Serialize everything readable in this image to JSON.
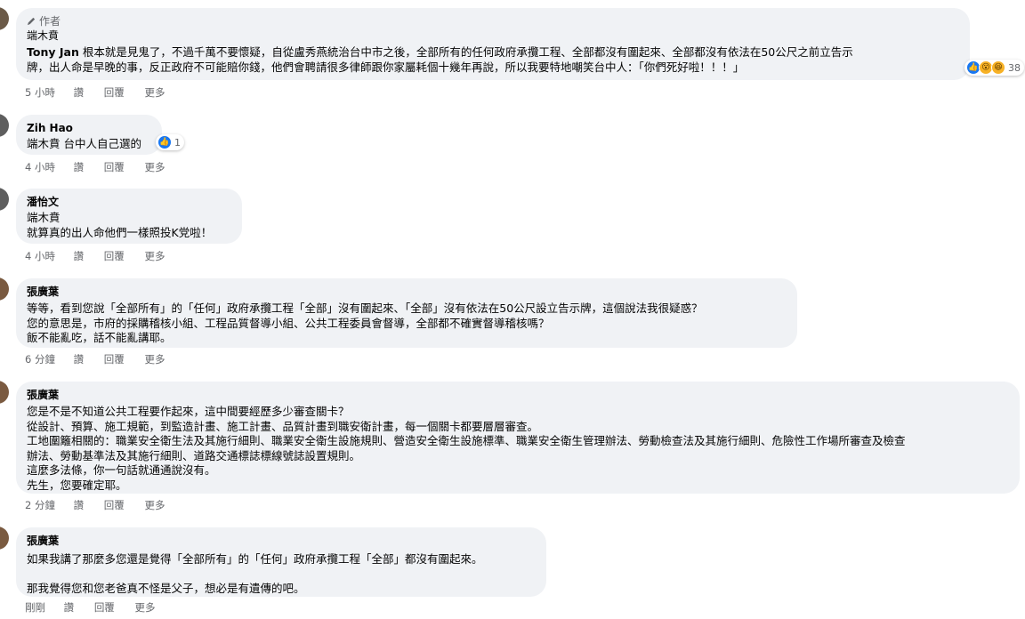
{
  "actions": {
    "like": "讚",
    "reply": "回覆",
    "more": "更多"
  },
  "comments": [
    {
      "badge": "作者",
      "author": "端木賁",
      "lines": [
        {
          "tag": "Tony Jan",
          "text": " 根本就是見鬼了，不過千萬不要懷疑，自從盧秀燕統治台中市之後，全部所有的任何政府承攬工程、全部都沒有圍起來、全部都沒有依法在50公尺之前立告示"
        },
        {
          "tag": "",
          "text": "牌，出人命是早晚的事，反正政府不可能賠你錢，他們會聘請很多律師跟你家屬耗個十幾年再說，所以我要特地嘲笑台中人：「你們死好啦！！！」"
        }
      ],
      "reactions": {
        "icons": [
          "like-icon",
          "wow-icon",
          "haha-icon"
        ],
        "count": "38"
      },
      "time": "5 小時"
    },
    {
      "author": "Zih Hao",
      "lines": [
        {
          "tag": "端木賁",
          "text": " 台中人自己選的"
        }
      ],
      "reactions": {
        "icons": [
          "like-icon"
        ],
        "count": "1"
      },
      "time": "4 小時"
    },
    {
      "author": "潘怡文",
      "lines": [
        {
          "tag": "端木賁",
          "text": ""
        },
        {
          "tag": "",
          "text": "就算真的出人命他們一樣照投K党啦！"
        }
      ],
      "time": "4 小時"
    },
    {
      "author": "張廣葉",
      "lines": [
        {
          "tag": "",
          "text": "等等，看到您說「全部所有」的「任何」政府承攬工程「全部」沒有圍起來、「全部」沒有依法在50公尺設立告示牌，這個說法我很疑惑？"
        },
        {
          "tag": "",
          "text": "您的意思是，市府的採購稽核小組、工程品質督導小組、公共工程委員會督導，全部都不確實督導稽核嗎？"
        },
        {
          "tag": "",
          "text": "飯不能亂吃，話不能亂講耶。"
        }
      ],
      "time": "6 分鐘"
    },
    {
      "author": "張廣葉",
      "lines": [
        {
          "tag": "",
          "text": "您是不是不知道公共工程要作起來，這中間要經歷多少審查關卡？"
        },
        {
          "tag": "",
          "text": "從設計、預算、施工規範，到監造計畫、施工計畫、品質計畫到職安衛計畫，每一個關卡都要層層審查。"
        },
        {
          "tag": "",
          "text": "工地圍籬相關的：職業安全衛生法及其施行細則、職業安全衛生設施規則、營造安全衛生設施標準、職業安全衛生管理辦法、勞動檢查法及其施行細則、危險性工作場所審查及檢查"
        },
        {
          "tag": "",
          "text": "辦法、勞動基準法及其施行細則、道路交通標誌標線號誌設置規則。"
        },
        {
          "tag": "",
          "text": "這麼多法條，你一句話就通通說沒有。"
        },
        {
          "tag": "",
          "text": "先生，您要確定耶。"
        }
      ],
      "time": "2 分鐘"
    },
    {
      "author": "張廣葉",
      "lines": [
        {
          "tag": "",
          "text": "如果我講了那麼多您還是覺得「全部所有」的「任何」政府承攬工程「全部」都沒有圍起來。"
        },
        {
          "tag": "",
          "text": ""
        },
        {
          "tag": "",
          "text": "那我覺得您和您老爸真不怪是父子，想必是有遺傳的吧。"
        }
      ],
      "time": "剛剛"
    }
  ]
}
